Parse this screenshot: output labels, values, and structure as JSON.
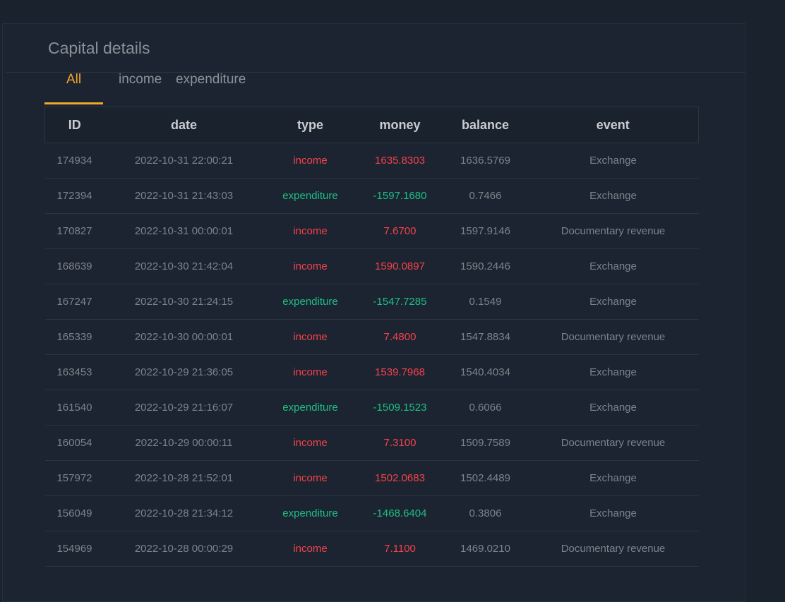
{
  "panel": {
    "title": "Capital details"
  },
  "tabs": [
    {
      "label": "All",
      "active": true
    },
    {
      "label": "income",
      "active": false
    },
    {
      "label": "expenditure",
      "active": false
    }
  ],
  "table": {
    "columns": [
      "ID",
      "date",
      "type",
      "money",
      "balance",
      "event"
    ],
    "rows": [
      {
        "id": "174934",
        "date": "2022-10-31 22:00:21",
        "type": "income",
        "money": "1635.8303",
        "balance": "1636.5769",
        "event": "Exchange"
      },
      {
        "id": "172394",
        "date": "2022-10-31 21:43:03",
        "type": "expenditure",
        "money": "-1597.1680",
        "balance": "0.7466",
        "event": "Exchange"
      },
      {
        "id": "170827",
        "date": "2022-10-31 00:00:01",
        "type": "income",
        "money": "7.6700",
        "balance": "1597.9146",
        "event": "Documentary revenue"
      },
      {
        "id": "168639",
        "date": "2022-10-30 21:42:04",
        "type": "income",
        "money": "1590.0897",
        "balance": "1590.2446",
        "event": "Exchange"
      },
      {
        "id": "167247",
        "date": "2022-10-30 21:24:15",
        "type": "expenditure",
        "money": "-1547.7285",
        "balance": "0.1549",
        "event": "Exchange"
      },
      {
        "id": "165339",
        "date": "2022-10-30 00:00:01",
        "type": "income",
        "money": "7.4800",
        "balance": "1547.8834",
        "event": "Documentary revenue"
      },
      {
        "id": "163453",
        "date": "2022-10-29 21:36:05",
        "type": "income",
        "money": "1539.7968",
        "balance": "1540.4034",
        "event": "Exchange"
      },
      {
        "id": "161540",
        "date": "2022-10-29 21:16:07",
        "type": "expenditure",
        "money": "-1509.1523",
        "balance": "0.6066",
        "event": "Exchange"
      },
      {
        "id": "160054",
        "date": "2022-10-29 00:00:11",
        "type": "income",
        "money": "7.3100",
        "balance": "1509.7589",
        "event": "Documentary revenue"
      },
      {
        "id": "157972",
        "date": "2022-10-28 21:52:01",
        "type": "income",
        "money": "1502.0683",
        "balance": "1502.4489",
        "event": "Exchange"
      },
      {
        "id": "156049",
        "date": "2022-10-28 21:34:12",
        "type": "expenditure",
        "money": "-1468.6404",
        "balance": "0.3806",
        "event": "Exchange"
      },
      {
        "id": "154969",
        "date": "2022-10-28 00:00:29",
        "type": "income",
        "money": "7.1100",
        "balance": "1469.0210",
        "event": "Documentary revenue"
      }
    ]
  },
  "colors": {
    "background": "#1a222d",
    "accent": "#f0a72b",
    "income": "#f5424c",
    "expenditure": "#1fbf85",
    "muted_text": "#7d838b",
    "header_text": "#c9ccd0"
  }
}
